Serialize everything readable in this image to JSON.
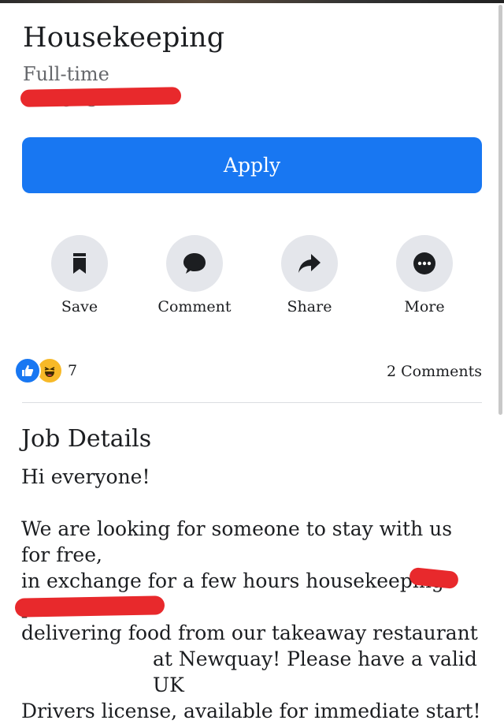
{
  "job": {
    "title": "Housekeeping",
    "type": "Full-time"
  },
  "apply_button": {
    "label": "Apply",
    "color": "#1877f2"
  },
  "actions": [
    {
      "label": "Save",
      "icon": "bookmark-icon"
    },
    {
      "label": "Comment",
      "icon": "comment-bubble-icon"
    },
    {
      "label": "Share",
      "icon": "share-arrow-icon"
    },
    {
      "label": "More",
      "icon": "more-dots-icon"
    }
  ],
  "engagement": {
    "reactions": [
      "like-reaction-icon",
      "haha-reaction-icon"
    ],
    "reaction_count": "7",
    "comments_label": "2 Comments"
  },
  "details": {
    "heading": "Job Details",
    "greeting": "Hi everyone!",
    "line1": "We are looking for someone to stay with us for free,",
    "line2": "in exchange for a few hours housekeeping - plus",
    "line3": "delivering food from our takeaway restaurant",
    "line4": "at Newquay! Please have a valid UK",
    "line5": "Drivers license, available for immediate start!"
  }
}
